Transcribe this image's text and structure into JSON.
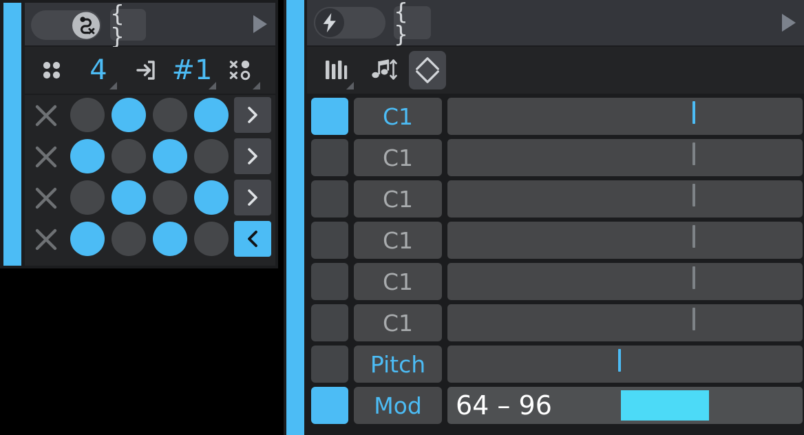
{
  "theme": {
    "accent": "#4cbcf5",
    "accent_bright": "#4cdaf7",
    "page_bg": "#000000",
    "panel_bg": "#1b1c1e",
    "topbar_bg": "#34363b",
    "toolbar_bg": "#232426",
    "cell_bg": "#464749",
    "dot_off": "#45474a",
    "text_dim": "#a8abad",
    "text_white": "#ffffff",
    "icon_grey": "#c9cccf"
  },
  "left_panel": {
    "topbar": {
      "toggle": {
        "name": "route-clear-toggle",
        "state": "on",
        "knob_side": "right",
        "icon": "path-route-x-icon"
      },
      "brace_button": {
        "name": "brace-button",
        "label": "{ }"
      },
      "play_button": {
        "name": "play-icon",
        "label": ""
      }
    },
    "toolbar": [
      {
        "name": "grid-dots-icon",
        "type": "icon",
        "icon": "four-dots-icon",
        "label": "",
        "has_corner": false
      },
      {
        "name": "steps-value",
        "type": "value",
        "icon": "",
        "label": "4",
        "has_corner": true
      },
      {
        "name": "input-arrow-icon",
        "type": "icon",
        "icon": "arrow-into-box-icon",
        "label": "",
        "has_corner": false
      },
      {
        "name": "pattern-number-value",
        "type": "value",
        "icon": "",
        "label": "#1",
        "has_corner": true
      },
      {
        "name": "randomize-icon",
        "type": "icon",
        "icon": "x-circle-matrix-icon",
        "label": "",
        "has_corner": true
      }
    ],
    "grid": {
      "column_count": 4,
      "rows": [
        {
          "name": "grid-row-1",
          "clear_label": "×",
          "steps": [
            false,
            true,
            false,
            true
          ],
          "arrow": {
            "glyph": "›",
            "dir": "right",
            "active": false
          }
        },
        {
          "name": "grid-row-2",
          "clear_label": "×",
          "steps": [
            true,
            false,
            true,
            false
          ],
          "arrow": {
            "glyph": "›",
            "dir": "right",
            "active": false
          }
        },
        {
          "name": "grid-row-3",
          "clear_label": "×",
          "steps": [
            false,
            true,
            false,
            true
          ],
          "arrow": {
            "glyph": "›",
            "dir": "right",
            "active": false
          }
        },
        {
          "name": "grid-row-4",
          "clear_label": "×",
          "steps": [
            true,
            false,
            true,
            false
          ],
          "arrow": {
            "glyph": "‹",
            "dir": "left",
            "active": true
          }
        }
      ]
    }
  },
  "right_panel": {
    "topbar": {
      "toggle": {
        "name": "velocity-toggle",
        "state": "off",
        "knob_side": "left",
        "icon": "lightning-bolt-icon"
      },
      "brace_button": {
        "name": "brace-button",
        "label": "{ }"
      },
      "play_button": {
        "name": "play-icon",
        "label": ""
      }
    },
    "toolbar": [
      {
        "name": "piano-keys-icon",
        "icon": "piano-keys-icon",
        "has_corner": true,
        "boxed": false
      },
      {
        "name": "note-updown-icon",
        "icon": "note-arrow-updown-icon",
        "has_corner": false,
        "boxed": false
      },
      {
        "name": "diamond-chevron-icon",
        "icon": "diamond-updown-icon",
        "has_corner": false,
        "boxed": true
      }
    ],
    "lanes": [
      {
        "name": "lane-note-1",
        "swatch": "on",
        "label": "C1",
        "label_style": "selected",
        "control": "slider",
        "slider_pos_pct": 69.5,
        "tick_color": "blue",
        "value_text": "",
        "range": null
      },
      {
        "name": "lane-note-2",
        "swatch": "off",
        "label": "C1",
        "label_style": "dim",
        "control": "slider",
        "slider_pos_pct": 69.5,
        "tick_color": "grey",
        "value_text": "",
        "range": null
      },
      {
        "name": "lane-note-3",
        "swatch": "off",
        "label": "C1",
        "label_style": "dim",
        "control": "slider",
        "slider_pos_pct": 69.5,
        "tick_color": "grey",
        "value_text": "",
        "range": null
      },
      {
        "name": "lane-note-4",
        "swatch": "off",
        "label": "C1",
        "label_style": "dim",
        "control": "slider",
        "slider_pos_pct": 69.5,
        "tick_color": "grey",
        "value_text": "",
        "range": null
      },
      {
        "name": "lane-note-5",
        "swatch": "off",
        "label": "C1",
        "label_style": "dim",
        "control": "slider",
        "slider_pos_pct": 69.5,
        "tick_color": "grey",
        "value_text": "",
        "range": null
      },
      {
        "name": "lane-note-6",
        "swatch": "off",
        "label": "C1",
        "label_style": "dim",
        "control": "slider",
        "slider_pos_pct": 69.5,
        "tick_color": "grey",
        "value_text": "",
        "range": null
      },
      {
        "name": "lane-pitch",
        "swatch": "off",
        "label": "Pitch",
        "label_style": "selected",
        "control": "slider",
        "slider_pos_pct": 48.5,
        "tick_color": "blue",
        "value_text": "",
        "range": null
      },
      {
        "name": "lane-mod",
        "swatch": "on",
        "label": "Mod",
        "label_style": "selected",
        "control": "range",
        "slider_pos_pct": 1.5,
        "tick_color": "none",
        "value_text": "64 – 96",
        "range": {
          "low": 64,
          "high": 96,
          "fill_start_pct": 49.0,
          "fill_width_pct": 24.0
        }
      }
    ]
  }
}
